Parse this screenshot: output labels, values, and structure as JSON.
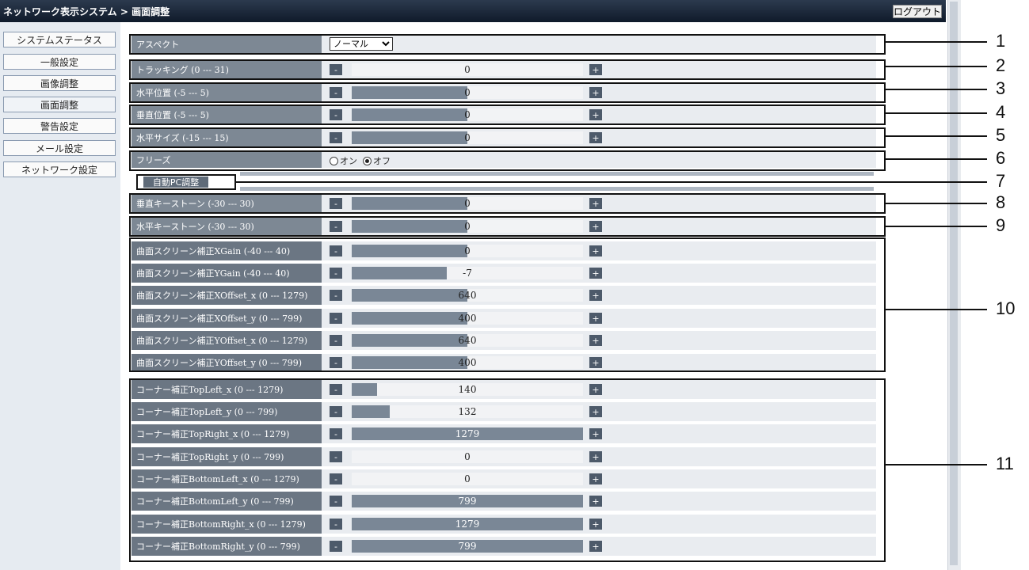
{
  "header": {
    "title": "ネットワーク表示システム",
    "separator": " > ",
    "page": "画面調整",
    "logout_label": "ログアウト"
  },
  "sidebar": {
    "items": [
      {
        "label": "システムステータス"
      },
      {
        "label": "一般設定"
      },
      {
        "label": "画像調整"
      },
      {
        "label": "画面調整",
        "active": true
      },
      {
        "label": "警告設定"
      },
      {
        "label": "メール設定"
      },
      {
        "label": "ネットワーク設定"
      }
    ]
  },
  "controls": {
    "minus": "-",
    "plus": "+",
    "aspect": {
      "label": "アスペクト",
      "value": "ノーマル"
    },
    "freeze": {
      "label": "フリーズ",
      "on": "オン",
      "off": "オフ",
      "selected": "off"
    },
    "auto_pc": {
      "label": "自動PC調整"
    }
  },
  "sliders": [
    {
      "label": "トラッキング (0 --- 31)",
      "value": "0",
      "fraction": 0
    },
    {
      "label": "水平位置 (-5 --- 5)",
      "value": "0",
      "fraction": 0.5
    },
    {
      "label": "垂直位置 (-5 --- 5)",
      "value": "0",
      "fraction": 0.5
    },
    {
      "label": "水平サイズ (-15 --- 15)",
      "value": "0",
      "fraction": 0.5
    },
    {
      "label": "垂直キーストーン (-30 --- 30)",
      "value": "0",
      "fraction": 0.5
    },
    {
      "label": "水平キーストーン (-30 --- 30)",
      "value": "0",
      "fraction": 0.5
    },
    {
      "label": "曲面スクリーン補正XGain (-40 --- 40)",
      "value": "0",
      "fraction": 0.5
    },
    {
      "label": "曲面スクリーン補正YGain (-40 --- 40)",
      "value": "-7",
      "fraction": 0.4125
    },
    {
      "label": "曲面スクリーン補正XOffset_x (0 --- 1279)",
      "value": "640",
      "fraction": 0.5
    },
    {
      "label": "曲面スクリーン補正XOffset_y (0 --- 799)",
      "value": "400",
      "fraction": 0.5
    },
    {
      "label": "曲面スクリーン補正YOffset_x (0 --- 1279)",
      "value": "640",
      "fraction": 0.5
    },
    {
      "label": "曲面スクリーン補正YOffset_y (0 --- 799)",
      "value": "400",
      "fraction": 0.5
    },
    {
      "label": "コーナー補正TopLeft_x (0 --- 1279)",
      "value": "140",
      "fraction": 0.11
    },
    {
      "label": "コーナー補正TopLeft_y (0 --- 799)",
      "value": "132",
      "fraction": 0.165
    },
    {
      "label": "コーナー補正TopRight_x (0 --- 1279)",
      "value": "1279",
      "fraction": 1.0
    },
    {
      "label": "コーナー補正TopRight_y (0 --- 799)",
      "value": "0",
      "fraction": 0
    },
    {
      "label": "コーナー補正BottomLeft_x (0 --- 1279)",
      "value": "0",
      "fraction": 0
    },
    {
      "label": "コーナー補正BottomLeft_y (0 --- 799)",
      "value": "799",
      "fraction": 1.0
    },
    {
      "label": "コーナー補正BottomRight_x (0 --- 1279)",
      "value": "1279",
      "fraction": 1.0
    },
    {
      "label": "コーナー補正BottomRight_y (0 --- 799)",
      "value": "799",
      "fraction": 1.0
    }
  ],
  "callouts": [
    "1",
    "2",
    "3",
    "4",
    "5",
    "6",
    "7",
    "8",
    "9",
    "10",
    "11"
  ]
}
